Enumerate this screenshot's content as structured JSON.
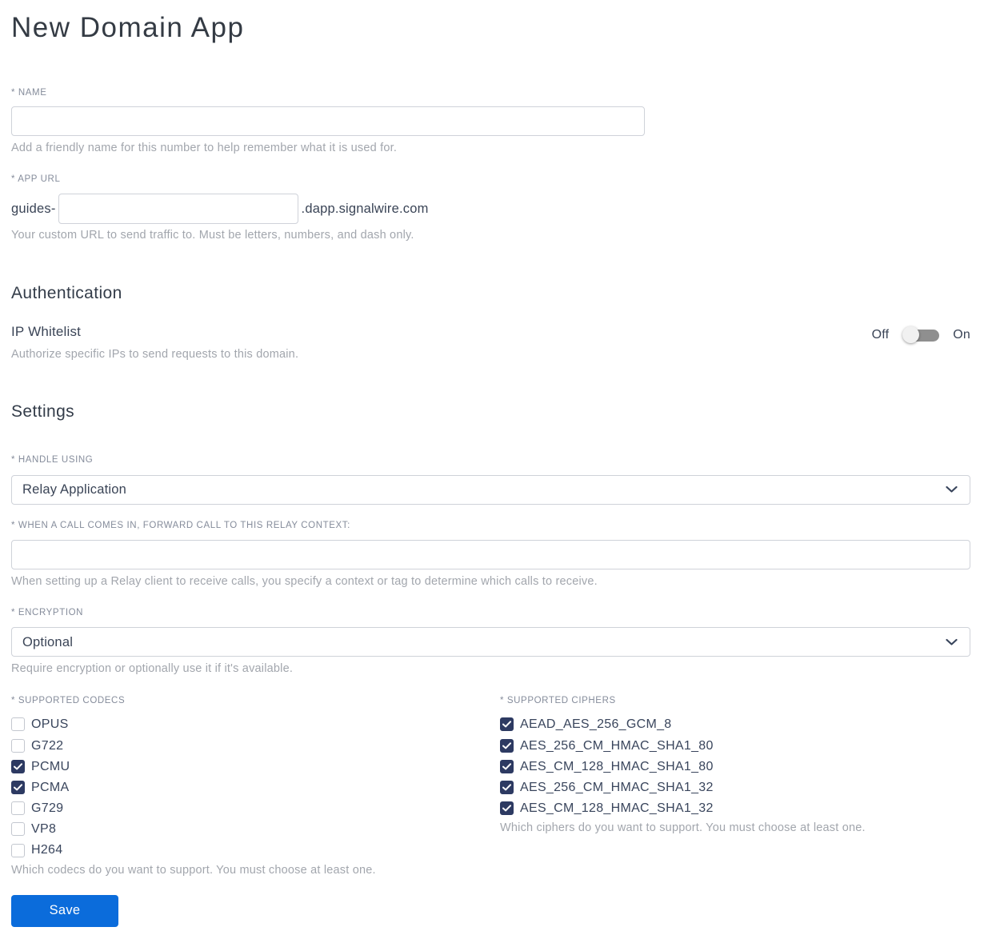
{
  "colors": {
    "accent_blue": "#0b6cdb",
    "checkbox_checked": "#2d3a62",
    "toggle_track": "#8f8f8f",
    "toggle_knob": "#f1f1f1"
  },
  "page": {
    "title": "New Domain App"
  },
  "name_field": {
    "label": "* NAME",
    "value": "",
    "helper": "Add a friendly name for this number to help remember what it is used for."
  },
  "app_url_field": {
    "label": "* APP URL",
    "prefix": "guides-",
    "value": "",
    "suffix": ".dapp.signalwire.com",
    "helper": "Your custom URL to send traffic to. Must be letters, numbers, and dash only."
  },
  "authentication": {
    "heading": "Authentication",
    "ip_whitelist": {
      "label": "IP Whitelist",
      "helper": "Authorize specific IPs to send requests to this domain.",
      "off_label": "Off",
      "on_label": "On",
      "state": "off"
    }
  },
  "settings": {
    "heading": "Settings",
    "handle_using": {
      "label": "* HANDLE USING",
      "value": "Relay Application"
    },
    "relay_context": {
      "label": "* WHEN A CALL COMES IN, FORWARD CALL TO THIS RELAY CONTEXT:",
      "value": "",
      "helper": "When setting up a Relay client to receive calls, you specify a context or tag to determine which calls to receive."
    },
    "encryption": {
      "label": "* ENCRYPTION",
      "value": "Optional",
      "helper": "Require encryption or optionally use it if it's available."
    },
    "codecs": {
      "label": "* SUPPORTED CODECS",
      "items": [
        {
          "label": "OPUS",
          "checked": false
        },
        {
          "label": "G722",
          "checked": false
        },
        {
          "label": "PCMU",
          "checked": true
        },
        {
          "label": "PCMA",
          "checked": true
        },
        {
          "label": "G729",
          "checked": false
        },
        {
          "label": "VP8",
          "checked": false
        },
        {
          "label": "H264",
          "checked": false
        }
      ],
      "helper": "Which codecs do you want to support. You must choose at least one."
    },
    "ciphers": {
      "label": "* SUPPORTED CIPHERS",
      "items": [
        {
          "label": "AEAD_AES_256_GCM_8",
          "checked": true
        },
        {
          "label": "AES_256_CM_HMAC_SHA1_80",
          "checked": true
        },
        {
          "label": "AES_CM_128_HMAC_SHA1_80",
          "checked": true
        },
        {
          "label": "AES_256_CM_HMAC_SHA1_32",
          "checked": true
        },
        {
          "label": "AES_CM_128_HMAC_SHA1_32",
          "checked": true
        }
      ],
      "helper": "Which ciphers do you want to support. You must choose at least one."
    }
  },
  "save_button_label": "Save"
}
